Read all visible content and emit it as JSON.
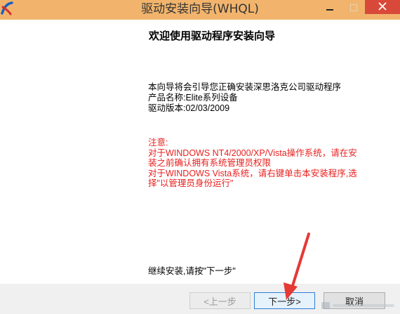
{
  "window": {
    "title": "驱动安装向导(WHQL)"
  },
  "colors": {
    "titlebar": "#f2b46c",
    "close_button": "#d9493a",
    "warning_text": "#e8201e",
    "annotation_arrow": "#e53935"
  },
  "icons": {
    "app": "app-logo-icon",
    "minimize": "minimize-icon",
    "maximize": "maximize-icon",
    "close": "close-icon"
  },
  "content": {
    "heading": "欢迎使用驱动程序安装向导",
    "intro_lines": [
      "本向导将会引导您正确安装深思洛克公司驱动程序",
      "产品名称:Elite系列设备",
      "驱动版本:02/03/2009"
    ],
    "warning_lines": [
      "注意:",
      "对于WINDOWS NT4/2000/XP/Vista操作系统，请在安",
      "装之前确认拥有系统管理员权限",
      "对于WINDOWS Vista系统，请右键单击本安装程序,选",
      "择\"以管理员身份运行\""
    ],
    "continue_text": "继续安装,请按\"下一步\""
  },
  "buttons": {
    "back": "<上一步",
    "next": "下一步>",
    "cancel": "取消"
  }
}
